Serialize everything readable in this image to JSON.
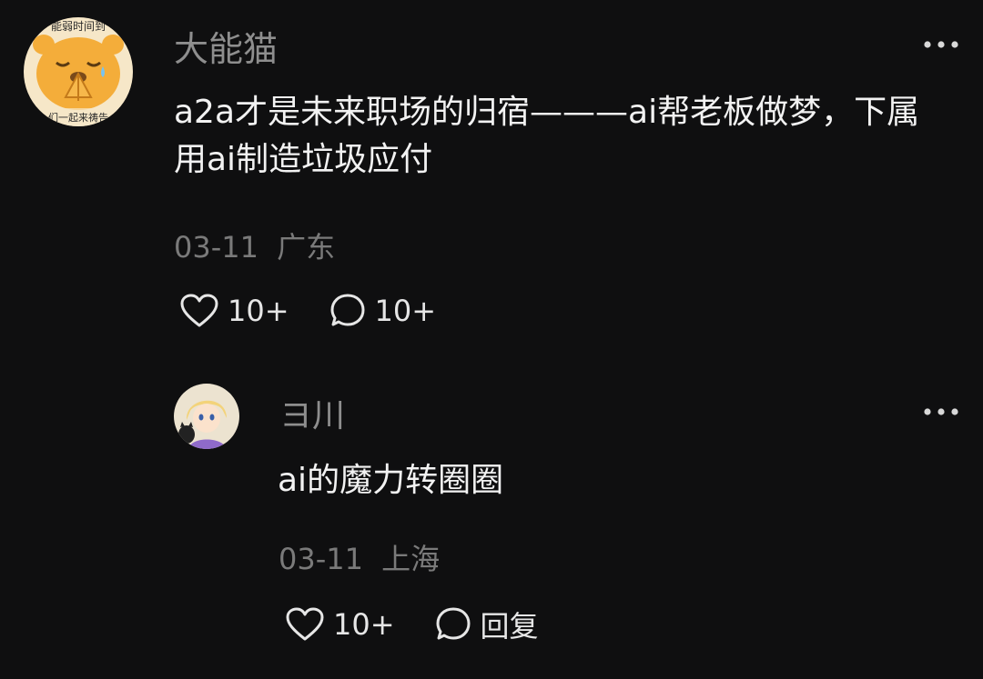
{
  "colors": {
    "background": "#0f0f10",
    "author": "#8e8e8e",
    "body": "#f2f2f2",
    "meta": "#7a7a7a",
    "action": "#e6e6e6"
  },
  "comment": {
    "author": "大能猫",
    "text": "a2a才是未来职场的归宿———ai帮老板做梦，下属用ai制造垃圾应付",
    "date": "03-11",
    "location": "广东",
    "likes": "10+",
    "replies": "10+",
    "avatar_icon": "cartoon-bear-praying-icon",
    "avatar_caption_top": "能弱时间到",
    "avatar_caption_bottom": "们一起来祷告"
  },
  "reply": {
    "author": "ヨ川",
    "text": "ai的魔力转圈圈",
    "date": "03-11",
    "location": "上海",
    "likes": "10+",
    "reply_label": "回复",
    "avatar_icon": "anime-girl-with-cat-icon"
  }
}
